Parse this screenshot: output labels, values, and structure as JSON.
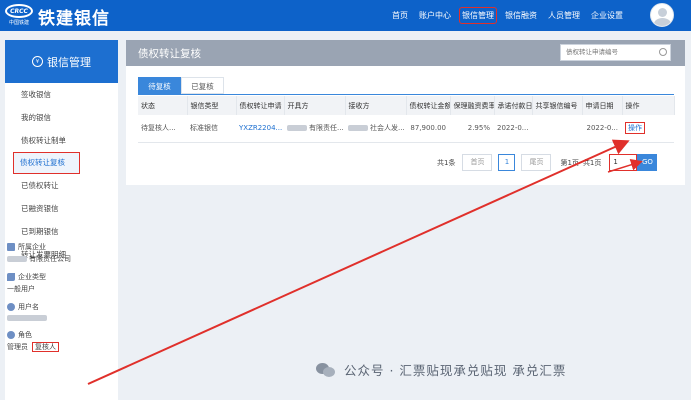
{
  "app": {
    "logo_text": "CRCC",
    "logo_sub": "中国铁建",
    "brand": "铁建银信"
  },
  "nav": [
    "首页",
    "账户中心",
    "银信管理",
    "银信融资",
    "人员管理",
    "企业设置"
  ],
  "sidebar": {
    "title": "银信管理",
    "items": [
      "签收银信",
      "我的银信",
      "债权转让制单",
      "债权转让复核",
      "已债权转让",
      "已融资银信",
      "已到期银信",
      "转让发票明细"
    ],
    "company_label": "所属企业",
    "company_value": "有限责任公司",
    "type_label": "企业类型",
    "type_value": "一般用户",
    "user_label": "用户名",
    "role_label": "角色",
    "role_value": "管理员",
    "role_highlight": "复核人"
  },
  "page": {
    "title": "债权转让复核",
    "search_placeholder": "债权转让申请编号"
  },
  "tabs": [
    "待复核",
    "已复核"
  ],
  "table": {
    "headers": [
      "状态",
      "银信类型",
      "债权转让申请",
      "开具方",
      "接收方",
      "债权转让金额",
      "保理融资费率",
      "承诺付款日",
      "共享银信编号",
      "申请日期",
      "操作"
    ],
    "rows": [
      [
        "待复核人...",
        "标准银信",
        "YXZR2204...",
        "有限责任...",
        "社会人发...",
        "87,900.00",
        "2.95%",
        "2022-0...",
        "",
        "2022-0...",
        "操作"
      ]
    ]
  },
  "pager": {
    "total": "共1条",
    "first": "首页",
    "page": "1",
    "last": "尾页",
    "page_of": "第1页",
    "pages_total": "共1页",
    "input_value": "1",
    "go": "GO"
  },
  "watermark": "公众号 · 汇票贴现承兑贴现 承兑汇票"
}
